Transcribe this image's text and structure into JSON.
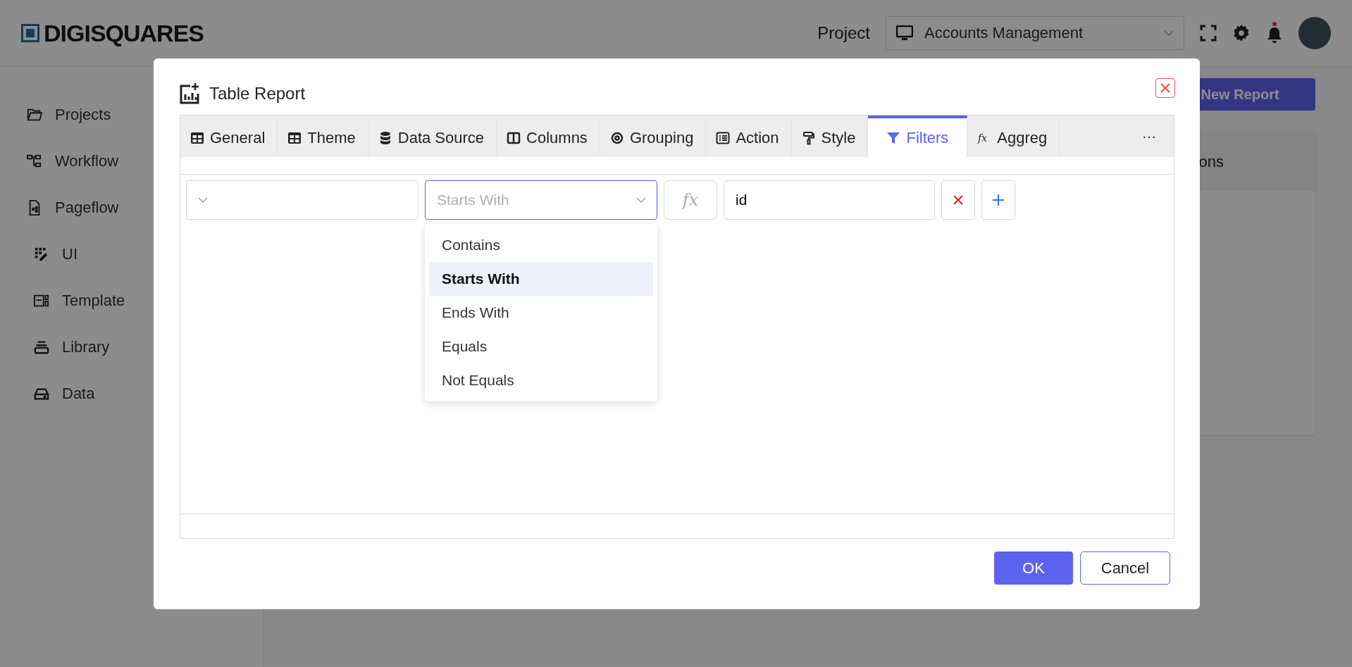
{
  "header": {
    "logo": "DIGISQUARES",
    "project_label": "Project",
    "project_select": {
      "value": "Accounts Management"
    }
  },
  "sidebar": {
    "items": [
      {
        "label": "Projects",
        "kind": "folder"
      },
      {
        "label": "Workflow",
        "kind": "workflow"
      },
      {
        "label": "Pageflow",
        "kind": "page"
      },
      {
        "label": "UI",
        "kind": "ui"
      },
      {
        "label": "Template",
        "kind": "template"
      },
      {
        "label": "Library",
        "kind": "library"
      },
      {
        "label": "Data",
        "kind": "data"
      }
    ]
  },
  "main": {
    "new_report_button": "New Report",
    "card_heading": "ons"
  },
  "dialog": {
    "title": "Table Report",
    "tabs": [
      {
        "label": "General",
        "kind": "table",
        "selected": false
      },
      {
        "label": "Theme",
        "kind": "table",
        "selected": false
      },
      {
        "label": "Data Source",
        "kind": "database",
        "selected": false
      },
      {
        "label": "Columns",
        "kind": "columns",
        "selected": false
      },
      {
        "label": "Grouping",
        "kind": "grouping",
        "selected": false
      },
      {
        "label": "Action",
        "kind": "list",
        "selected": false
      },
      {
        "label": "Style",
        "kind": "roller",
        "selected": false
      },
      {
        "label": "Filters",
        "kind": "filter",
        "selected": true
      },
      {
        "label": "Aggreg",
        "kind": "fx",
        "selected": false
      }
    ],
    "more_tabs": "···",
    "filter_row": {
      "operator_select": {
        "placeholder": "Starts With",
        "expanded": true
      },
      "fx_button": "fx",
      "value_input": {
        "value": "id"
      }
    },
    "operator_options": [
      {
        "label": "Contains",
        "selected": false
      },
      {
        "label": "Starts With",
        "selected": true
      },
      {
        "label": "Ends With",
        "selected": false
      },
      {
        "label": "Equals",
        "selected": false
      },
      {
        "label": "Not Equals",
        "selected": false
      }
    ],
    "buttons": {
      "ok": "OK",
      "cancel": "Cancel"
    }
  }
}
